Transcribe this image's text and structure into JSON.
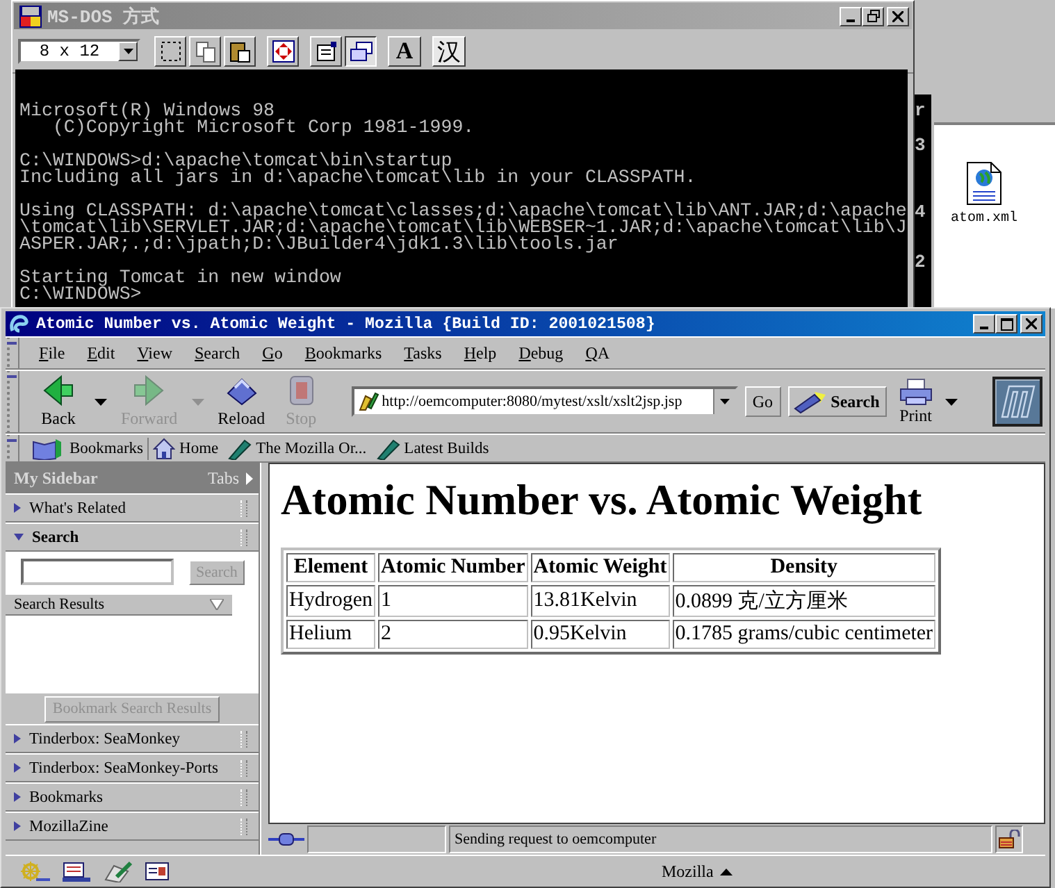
{
  "background_window": {
    "file": {
      "name": "atom.xml"
    },
    "edge_chars": [
      "r",
      "3",
      "4",
      "2"
    ]
  },
  "dos_window": {
    "title": "MS-DOS 方式",
    "font_size": "8 x 12",
    "text_buttons": [
      "A",
      "汉"
    ],
    "console": [
      [
        "Microsoft(R) Windows 98",
        "   (C)Copyright Microsoft Corp 1981-1999."
      ],
      [
        "C:\\WINDOWS>d:\\apache\\tomcat\\bin\\startup",
        "Including all jars in d:\\apache\\tomcat\\lib in your CLASSPATH."
      ],
      [
        "Using CLASSPATH: d:\\apache\\tomcat\\classes;d:\\apache\\tomcat\\lib\\ANT.JAR;d:\\apache",
        "\\tomcat\\lib\\SERVLET.JAR;d:\\apache\\tomcat\\lib\\WEBSER~1.JAR;d:\\apache\\tomcat\\lib\\J",
        "ASPER.JAR;.;d:\\jpath;D:\\JBuilder4\\jdk1.3\\lib\\tools.jar"
      ],
      [
        "Starting Tomcat in new window",
        "C:\\WINDOWS>"
      ]
    ]
  },
  "browser": {
    "title": "Atomic Number vs. Atomic Weight - Mozilla {Build ID: 2001021508}",
    "menu": [
      "File",
      "Edit",
      "View",
      "Search",
      "Go",
      "Bookmarks",
      "Tasks",
      "Help",
      "Debug",
      "QA"
    ],
    "nav_buttons": [
      {
        "label": "Back",
        "kind": "back",
        "disabled": false,
        "dropdown": true
      },
      {
        "label": "Forward",
        "kind": "forward",
        "disabled": true,
        "dropdown": true
      },
      {
        "label": "Reload",
        "kind": "reload",
        "disabled": false,
        "dropdown": false
      },
      {
        "label": "Stop",
        "kind": "stop",
        "disabled": true,
        "dropdown": false
      }
    ],
    "url": "http://oemcomputer:8080/mytest/xslt/xslt2jsp.jsp",
    "go": "Go",
    "search": "Search",
    "print": "Print",
    "personal_toolbar": [
      {
        "label": "Bookmarks",
        "kind": "folder"
      },
      {
        "label": "Home",
        "kind": "home"
      },
      {
        "label": "The Mozilla Or...",
        "kind": "link"
      },
      {
        "label": "Latest Builds",
        "kind": "link"
      }
    ],
    "sidebar": {
      "title": "My Sidebar",
      "tabs": "Tabs",
      "search_button": "Search",
      "results_label": "Search Results",
      "bookmark_button": "Bookmark Search Results",
      "panels": [
        {
          "label": "What's Related",
          "expanded": false
        },
        {
          "label": "Search",
          "expanded": true
        },
        {
          "label": "Tinderbox: SeaMonkey",
          "expanded": false
        },
        {
          "label": "Tinderbox: SeaMonkey-Ports",
          "expanded": false
        },
        {
          "label": "Bookmarks",
          "expanded": false
        },
        {
          "label": "MozillaZine",
          "expanded": false
        }
      ]
    },
    "page": {
      "heading": "Atomic Number vs. Atomic Weight",
      "table": {
        "columns": [
          "Element",
          "Atomic Number",
          "Atomic Weight",
          "Density"
        ],
        "rows": [
          [
            "Hydrogen",
            "1",
            "13.81Kelvin",
            "0.0899 克/立方厘米"
          ],
          [
            "Helium",
            "2",
            "0.95Kelvin",
            "0.1785 grams/cubic centimeter"
          ]
        ]
      }
    },
    "status": "Sending request to oemcomputer",
    "component_bar": {
      "label": "Mozilla"
    }
  }
}
